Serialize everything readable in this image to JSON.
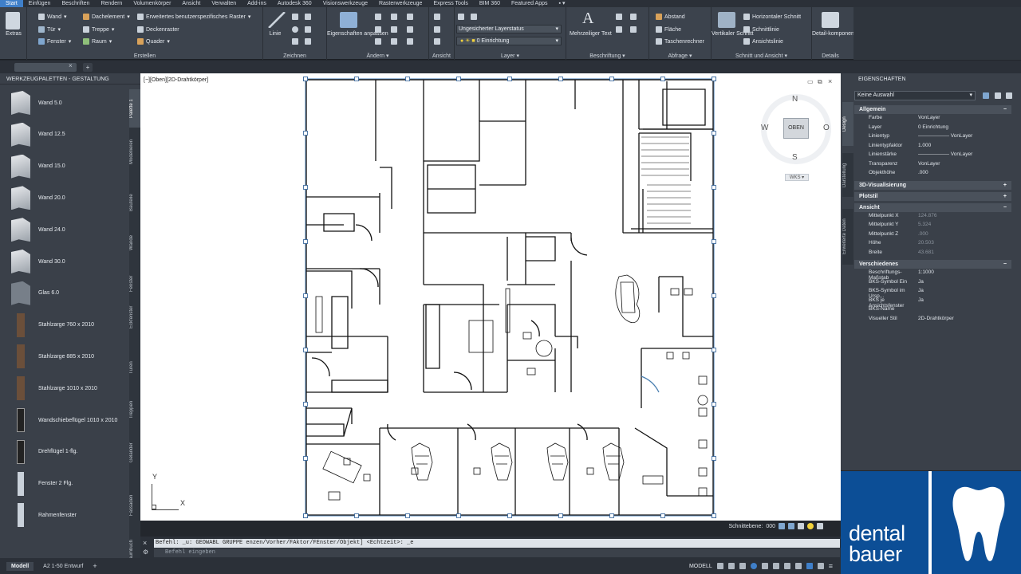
{
  "menubar": [
    "Start",
    "Einfügen",
    "Beschriften",
    "Rendern",
    "Volumenkörper",
    "Ansicht",
    "Verwalten",
    "Add-ins",
    "Autodesk 360",
    "Visionswerkzeuge",
    "Rasterwerkzeuge",
    "Express Tools",
    "BIM 360",
    "Featured Apps"
  ],
  "ribbon": {
    "extras": "Extras",
    "erstellen": {
      "title": "Erstellen",
      "wand": "Wand",
      "tuer": "Tür",
      "fenster": "Fenster",
      "dachelement": "Dachelement",
      "treppe": "Treppe",
      "raum": "Raum",
      "raster": "Erweitertes benutzerspezifisches Raster",
      "deckenraster": "Deckenraster",
      "quader": "Quader"
    },
    "zeichnen": {
      "title": "Zeichnen",
      "linie": "Linie"
    },
    "aendern": {
      "title": "Ändern",
      "eigenschaften": "Eigenschaften anpassen"
    },
    "ansicht": {
      "title": "Ansicht"
    },
    "layer": {
      "title": "Layer",
      "status": "Ungesicherter Layerstatus",
      "current": "0 Einrichtung"
    },
    "beschriftung": {
      "title": "Beschriftung",
      "text": "Mehrzeiliger Text"
    },
    "abfrage": {
      "title": "Abfrage",
      "abstand": "Abstand",
      "flaeche": "Fläche",
      "rechner": "Taschenrechner"
    },
    "schnitt": {
      "title": "Schnitt und Ansicht",
      "vertikal": "Vertikaler Schnitt",
      "horizontal": "Horizontaler Schnitt",
      "schnittlinie": "Schnittlinie",
      "ansichtslinie": "Ansichtslinie"
    },
    "details": {
      "title": "Details",
      "komponenten": "Detail-komponenten"
    }
  },
  "palette": {
    "title": "WERKZEUGPALETTEN - GESTALTUNG",
    "items": [
      "Wand 5.0",
      "Wand 12.5",
      "Wand 15.0",
      "Wand 20.0",
      "Wand 24.0",
      "Wand 30.0",
      "Glas 6.0",
      "Stahlzarge 760 x 2010",
      "Stahlzarge 885 x 2010",
      "Stahlzarge 1010 x 2010",
      "Wandschiebeflügel 1010 x 2010",
      "Drehflügel 1-flg.",
      "Fenster 2 Flg.",
      "Rahmenfenster"
    ],
    "tabs": [
      "Palette 1",
      "Modellieren",
      "Bauteile",
      "Wände",
      "Fenster",
      "Eckfenster",
      "Türen",
      "Treppen",
      "Geländer",
      "Fassaden",
      "Raumbuch"
    ]
  },
  "viewport": {
    "label": "[−][Oben][2D-Drahtkörper]",
    "cube_top": "OBEN",
    "compass": {
      "n": "N",
      "s": "S",
      "w": "W",
      "o": "O"
    },
    "wks": "WKS",
    "axis_y": "Y",
    "axis_x": "X",
    "schnittebene_label": "Schnittebene:",
    "schnittebene_value": "000"
  },
  "command": {
    "history": "Befehl: _u: GEOWABL GRUPPE  enzen/Vorher/FAktor/FEnster/Objekt] <Echtzeit>: _e",
    "placeholder": "Befehl eingeben"
  },
  "status": {
    "tab_modell": "Modell",
    "tab_layout": "A2 1-50 Entwurf",
    "mode": "MODELL"
  },
  "properties": {
    "title": "EIGENSCHAFTEN",
    "selection": "Keine Auswahl",
    "sections": {
      "allgemein": "Allgemein",
      "visualisierung": "3D-Visualisierung",
      "plotstil": "Plotstil",
      "ansicht": "Ansicht",
      "verschiedenes": "Verschiedenes"
    },
    "allgemein_rows": [
      {
        "k": "Farbe",
        "v": "VonLayer"
      },
      {
        "k": "Layer",
        "v": "0 Einrichtung"
      },
      {
        "k": "Linientyp",
        "v": "—————— VonLayer"
      },
      {
        "k": "Linientypfaktor",
        "v": "1.000"
      },
      {
        "k": "Linienstärke",
        "v": "—————— VonLayer"
      },
      {
        "k": "Transparenz",
        "v": "VonLayer"
      },
      {
        "k": "Objekthöhe",
        "v": ".000"
      }
    ],
    "ansicht_rows": [
      {
        "k": "Mittelpunkt X",
        "v": "124.876"
      },
      {
        "k": "Mittelpunkt Y",
        "v": "5.324"
      },
      {
        "k": "Mittelpunkt Z",
        "v": ".000"
      },
      {
        "k": "Höhe",
        "v": "20.503"
      },
      {
        "k": "Breite",
        "v": "43.681"
      }
    ],
    "verschiedenes_rows": [
      {
        "k": "Beschriftungs-Maßstab",
        "v": "1:1000"
      },
      {
        "k": "BKS-Symbol Ein",
        "v": "Ja"
      },
      {
        "k": "BKS-Symbol im Ursp...",
        "v": "Ja"
      },
      {
        "k": "BKS je Ansichtsfenster",
        "v": "Ja"
      },
      {
        "k": "BKS-Name",
        "v": ""
      },
      {
        "k": "Visueller Stil",
        "v": "2D-Drahtkörper"
      }
    ],
    "sidetabs": [
      "Design",
      "Darstellung",
      "Erweiterte Daten"
    ]
  },
  "logo": {
    "line1": "dental",
    "line2": "bauer"
  },
  "colors": {
    "accent": "#3f7fc9",
    "brand": "#0c4e96"
  }
}
